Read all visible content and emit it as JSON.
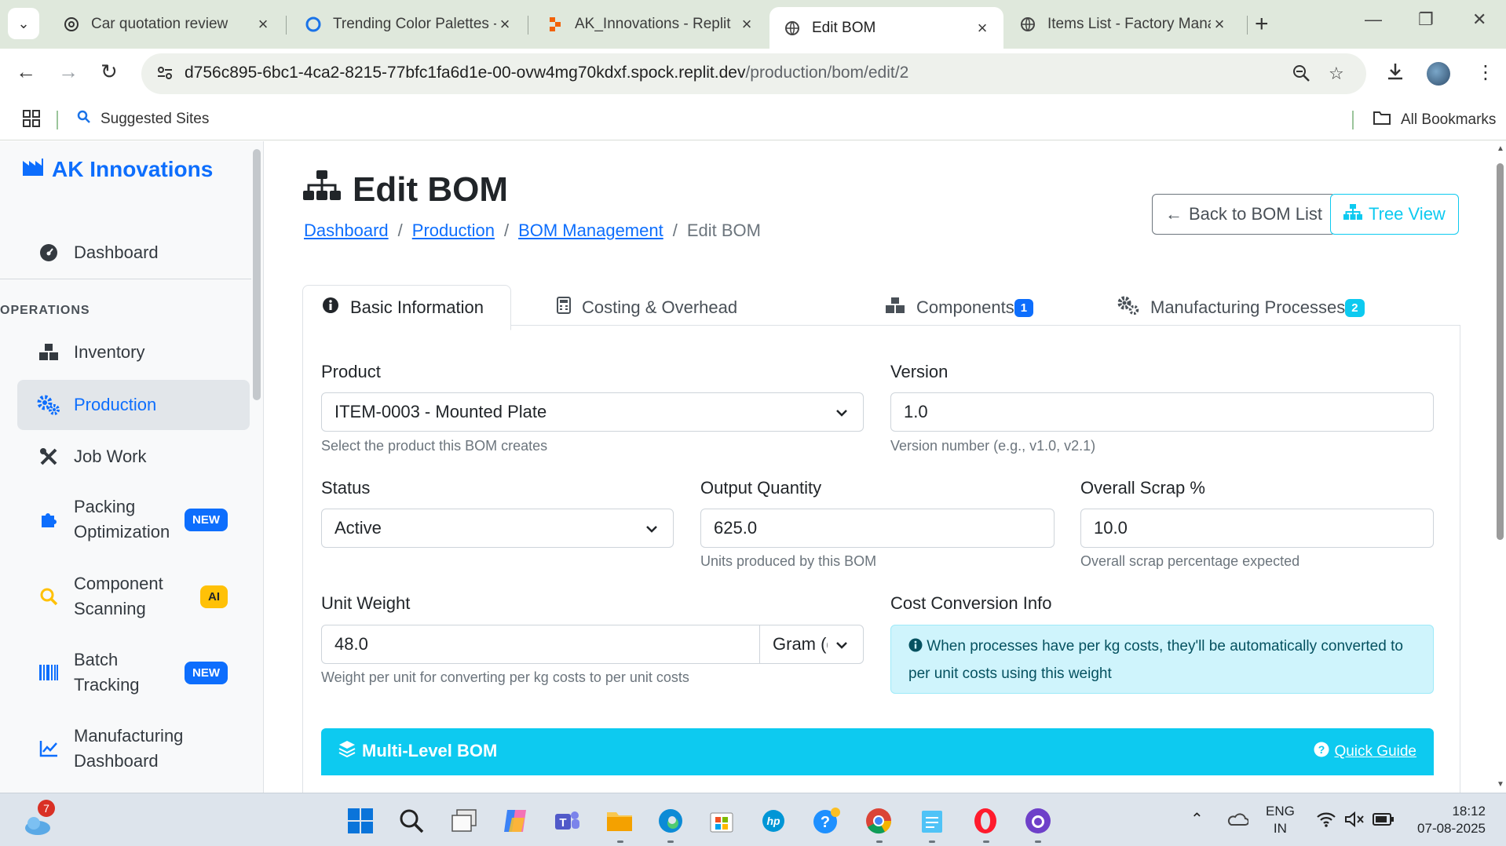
{
  "browser": {
    "tabs": [
      {
        "title": "Car quotation review",
        "icon": "openai-icon",
        "active": false
      },
      {
        "title": "Trending Color Palettes -",
        "icon": "palette-site-icon",
        "active": false
      },
      {
        "title": "AK_Innovations - Replit",
        "icon": "replit-icon",
        "active": false
      },
      {
        "title": "Edit BOM",
        "icon": "globe-icon",
        "active": true
      },
      {
        "title": "Items List - Factory Mana",
        "icon": "globe-icon",
        "active": false
      }
    ],
    "url_host": "d756c895-6bc1-4ca2-8215-77bfc1fa6d1e-00-ovw4mg70kdxf.spock.replit.dev",
    "url_path": "/production/bom/edit/2",
    "bookmarks": {
      "suggested": "Suggested Sites",
      "all": "All Bookmarks"
    }
  },
  "sidebar": {
    "brand": "AK Innovations",
    "dashboard": "Dashboard",
    "section": "OPERATIONS",
    "items": [
      {
        "label": "Inventory",
        "icon": "boxes-icon"
      },
      {
        "label": "Production",
        "icon": "gears-icon",
        "active": true
      },
      {
        "label": "Job Work",
        "icon": "tools-icon"
      },
      {
        "label_line1": "Packing",
        "label_line2": "Optimization",
        "badge": "NEW",
        "icon": "puzzle-icon"
      },
      {
        "label_line1": "Component",
        "label_line2": "Scanning",
        "badge": "AI",
        "icon": "search-icon"
      },
      {
        "label_line1": "Batch",
        "label_line2": "Tracking",
        "badge": "NEW",
        "icon": "barcode-icon"
      },
      {
        "label_line1": "Manufacturing",
        "label_line2": "Dashboard",
        "icon": "line-chart-icon"
      }
    ]
  },
  "page": {
    "title": "Edit BOM",
    "breadcrumb": [
      "Dashboard",
      "Production",
      "BOM Management",
      "Edit BOM"
    ],
    "back_button": "Back to BOM List",
    "tree_button": "Tree View"
  },
  "form_tabs": [
    {
      "label": "Basic Information",
      "icon": "info-circle-icon",
      "active": true
    },
    {
      "label": "Costing & Overhead",
      "icon": "calculator-icon"
    },
    {
      "label": "Components",
      "icon": "boxes-icon",
      "count": "1"
    },
    {
      "label": "Manufacturing Processes",
      "icon": "gears-icon",
      "count": "2"
    }
  ],
  "form": {
    "product": {
      "label": "Product",
      "value": "ITEM-0003 - Mounted Plate",
      "help": "Select the product this BOM creates"
    },
    "version": {
      "label": "Version",
      "value": "1.0",
      "help": "Version number (e.g., v1.0, v2.1)"
    },
    "status": {
      "label": "Status",
      "value": "Active"
    },
    "output_qty": {
      "label": "Output Quantity",
      "value": "625.0",
      "help": "Units produced by this BOM"
    },
    "scrap": {
      "label": "Overall Scrap %",
      "value": "10.0",
      "help": "Overall scrap percentage expected"
    },
    "unit_weight": {
      "label": "Unit Weight",
      "value": "48.0",
      "unit": "Gram (g",
      "help": "Weight per unit for converting per kg costs to per unit costs"
    },
    "cost_info": {
      "label": "Cost Conversion Info",
      "text": "When processes have per kg costs, they'll be automatically converted to per unit costs using this weight"
    }
  },
  "multilevel": {
    "title": "Multi-Level BOM",
    "guide": "Quick Guide"
  },
  "taskbar": {
    "weather_badge": "7",
    "lang_line1": "ENG",
    "lang_line2": "IN",
    "time": "18:12",
    "date": "07-08-2025"
  },
  "colors": {
    "primary": "#0d6efd",
    "info": "#0dcaf0",
    "warning": "#ffc107"
  }
}
